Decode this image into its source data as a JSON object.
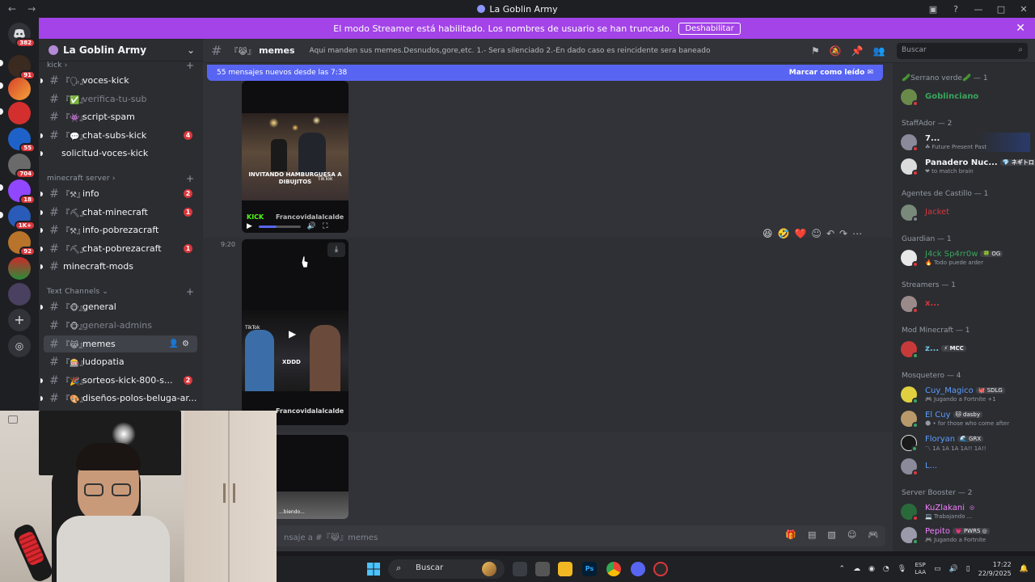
{
  "window": {
    "title": "La Goblin Army",
    "back": "←",
    "forward": "→"
  },
  "banner": {
    "text": "El modo Streamer está habilitado. Los nombres de usuario se han truncado.",
    "button": "Deshabilitar"
  },
  "server": {
    "name": "La Goblin Army"
  },
  "rail": {
    "badges": [
      "382",
      "91",
      "55",
      "704",
      "18",
      "1K+",
      "92"
    ]
  },
  "sidebar": {
    "categories": {
      "kick": "kick",
      "minecraft": "minecraft server",
      "text": "Text Channels"
    },
    "channels": [
      {
        "name": "voces-kick",
        "emoji": "『🗣』",
        "count": ""
      },
      {
        "name": "verifica-tu-sub",
        "emoji": "『✅』",
        "count": ""
      },
      {
        "name": "script-spam",
        "emoji": "『👾』",
        "count": ""
      },
      {
        "name": "chat-subs-kick",
        "emoji": "『💬』",
        "count": "4"
      },
      {
        "name": "solicitud-voces-kick",
        "emoji": "",
        "count": ""
      },
      {
        "name": "info",
        "emoji": "『⚒』",
        "count": "2"
      },
      {
        "name": "chat-minecraft",
        "emoji": "『⛏』",
        "count": "1"
      },
      {
        "name": "info-pobrezacraft",
        "emoji": "『⚒』",
        "count": ""
      },
      {
        "name": "chat-pobrezacraft",
        "emoji": "『⛏』",
        "count": "1"
      },
      {
        "name": "minecraft-mods",
        "emoji": "",
        "count": ""
      },
      {
        "name": "general",
        "emoji": "『🐵』",
        "count": ""
      },
      {
        "name": "general-admins",
        "emoji": "『🐵』",
        "count": ""
      },
      {
        "name": "memes",
        "emoji": "『😹』",
        "count": ""
      },
      {
        "name": "ludopatia",
        "emoji": "『🎰』",
        "count": ""
      },
      {
        "name": "sorteos-kick-800-s...",
        "emoji": "『🎉』",
        "count": "2"
      },
      {
        "name": "diseños-polos-beluga-ar...",
        "emoji": "『🎨』",
        "count": ""
      }
    ]
  },
  "channel": {
    "name": "memes",
    "emoji": "『😹』",
    "topic": "Aqui manden sus memes.Desnudos,gore,etc. 1.- Sera silenciado 2.-En dado caso es reincidente sera baneado",
    "search_placeholder": "Buscar"
  },
  "new_messages": {
    "text": "55 mensajes nuevos desde las 7:38",
    "mark_read": "Marcar como leído"
  },
  "messages": [
    {
      "caption": "INVITANDO HAMBURGUESA A DIBUJITOS",
      "watermark": "TikTok",
      "footer": "Francovidalalcalde",
      "brand": "KICK"
    },
    {
      "time": "9:20",
      "watermark": "TikTok",
      "caption": "XDDD",
      "footer": "Francovidalalcalde"
    },
    {
      "caption": "...biendo..."
    }
  ],
  "composer": {
    "placeholder": "Enviar mensaje a #『😹』memes",
    "visible": "nsaje a #『😹』memes"
  },
  "members": {
    "groups": [
      {
        "label": "🥒Serrano verde🥒 — 1"
      },
      {
        "label": "StaffAdor — 2"
      },
      {
        "label": "Agentes de Castillo — 1"
      },
      {
        "label": "Guardian — 1"
      },
      {
        "label": "Streamers — 1"
      },
      {
        "label": "Mod Minecraft — 1"
      },
      {
        "label": "Mosquetero — 4"
      },
      {
        "label": "Server Booster — 2"
      }
    ],
    "list": [
      {
        "name": "Goblinciano",
        "color": "#3ba55d",
        "tag": "",
        "activity": ""
      },
      {
        "name": "7...",
        "color": "#f2f3f5",
        "tag": "",
        "activity": "☘ Future Present Past"
      },
      {
        "name": "Panadero Nuc...",
        "color": "#f2f3f5",
        "tag": "💎 ネギトロ",
        "activity": "❤ to match brain"
      },
      {
        "name": "Jacket",
        "color": "#da373c",
        "tag": "",
        "activity": ""
      },
      {
        "name": "J4ck Sp4rr0w",
        "color": "#3ba55d",
        "tag": "🍀 OG",
        "activity": "🔥 Todo puede arder"
      },
      {
        "name": "x...",
        "color": "#da373c",
        "tag": "",
        "activity": ""
      },
      {
        "name": "z...",
        "color": "#6fc3df",
        "tag": "⚡ MCC",
        "activity": ""
      },
      {
        "name": "Cuy_Magico",
        "color": "#5c9dff",
        "tag": "🐙 SDLG",
        "activity": "🎮 Jugando a Fortnite +1"
      },
      {
        "name": "El Cuy",
        "color": "#5c9dff",
        "tag": "🐱 dasby",
        "activity": "🌑 • for those who come after"
      },
      {
        "name": "Floryan",
        "color": "#5c9dff",
        "tag": "🌊 GRX",
        "activity": "〽 1A 1A 1A 1A!! 1A!!"
      },
      {
        "name": "L...",
        "color": "#5c9dff",
        "tag": "",
        "activity": ""
      },
      {
        "name": "KuZlakani",
        "color": "#f47fff",
        "tag": "◎",
        "activity": "💻 Trabajando ..."
      },
      {
        "name": "Pepito",
        "color": "#f47fff",
        "tag": "💗 PWRS ◎",
        "activity": "🎮 Jugando a Fortnite"
      }
    ]
  },
  "taskbar": {
    "search": "Buscar",
    "lang1": "ESP",
    "lang2": "LAA",
    "time": "17:22",
    "date": "22/9/2025"
  }
}
